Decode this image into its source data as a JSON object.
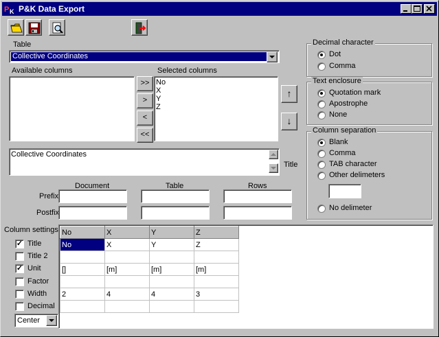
{
  "window": {
    "title": "P&K Data Export"
  },
  "table_section": {
    "label": "Table",
    "selected": "Collective Coordinates"
  },
  "columns": {
    "available_label": "Available columns",
    "selected_label": "Selected columns",
    "available_items": [],
    "selected_items": [
      "No",
      "X",
      "Y",
      "Z"
    ],
    "move_buttons": {
      "add_all": ">>",
      "add": ">",
      "remove": "<",
      "remove_all": "<<"
    },
    "order_buttons": {
      "up": "↑",
      "down": "↓"
    }
  },
  "title_section": {
    "label": "Title",
    "value": "Collective Coordinates"
  },
  "affix": {
    "headers": [
      "Document",
      "Table",
      "Rows"
    ],
    "prefix_label": "Prefix",
    "postfix_label": "Postfix"
  },
  "decimal_character": {
    "label": "Decimal character",
    "options": [
      {
        "label": "Dot",
        "selected": true
      },
      {
        "label": "Comma",
        "selected": false
      }
    ]
  },
  "text_enclosure": {
    "label": "Text enclosure",
    "options": [
      {
        "label": "Quotation mark",
        "selected": true
      },
      {
        "label": "Apostrophe",
        "selected": false
      },
      {
        "label": "None",
        "selected": false
      }
    ]
  },
  "column_separation": {
    "label": "Column separation",
    "options": [
      {
        "label": "Blank",
        "selected": true
      },
      {
        "label": "Comma",
        "selected": false
      },
      {
        "label": "TAB character",
        "selected": false
      },
      {
        "label": "Other delimeters",
        "selected": false
      }
    ],
    "no_delimiter": {
      "label": "No delimeter",
      "selected": false
    }
  },
  "column_settings": {
    "label": "Column settings",
    "checkboxes": [
      {
        "label": "Title",
        "checked": true
      },
      {
        "label": "Title 2",
        "checked": false
      },
      {
        "label": "Unit",
        "checked": true
      },
      {
        "label": "Factor",
        "checked": false
      },
      {
        "label": "Width",
        "checked": false
      },
      {
        "label": "Decimal",
        "checked": false
      }
    ],
    "alignment": "Center",
    "grid": {
      "headers": [
        "No",
        "X",
        "Y",
        "Z"
      ],
      "rows": [
        [
          "No",
          "X",
          "Y",
          "Z"
        ],
        [
          "",
          "",
          "",
          ""
        ],
        [
          "[]",
          "[m]",
          "[m]",
          "[m]"
        ],
        [
          "",
          "",
          "",
          ""
        ],
        [
          "2",
          "4",
          "4",
          "3"
        ],
        [
          "",
          "",
          "",
          ""
        ]
      ]
    }
  },
  "toolbar": {
    "icons": [
      "open-folder-icon",
      "save-disk-icon",
      "print-preview-icon",
      "exit-door-icon"
    ]
  }
}
